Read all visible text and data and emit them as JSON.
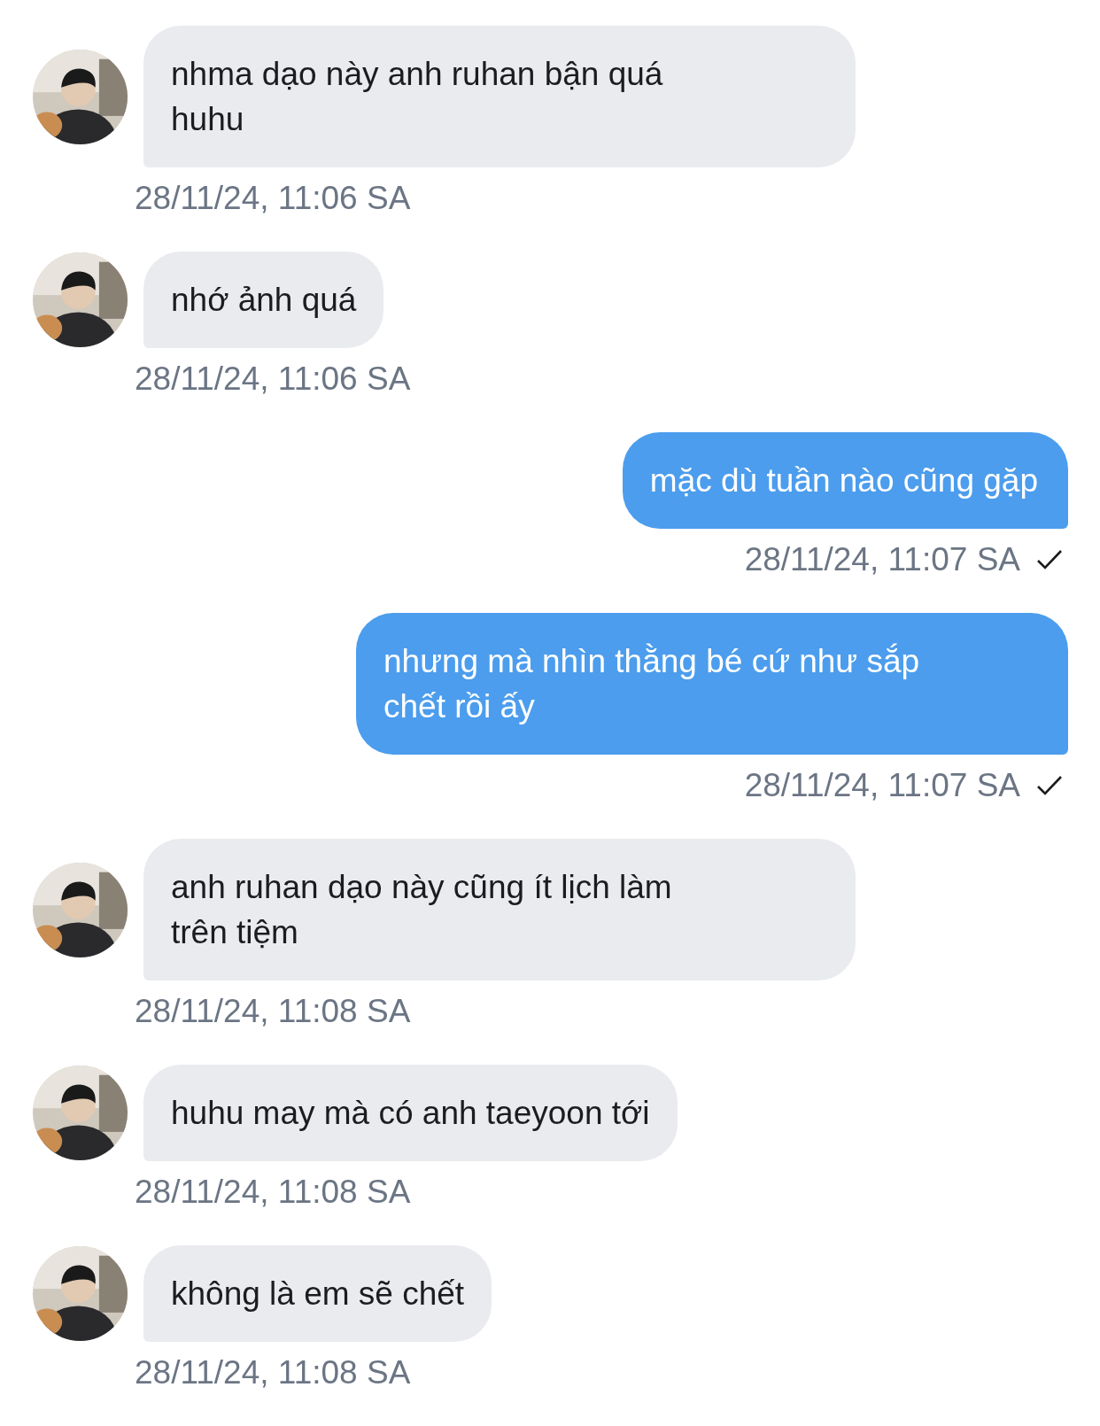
{
  "messages": [
    {
      "kind": "received",
      "avatar": {
        "kind": "picture"
      },
      "lines": [
        "nhma dạo này anh ruhan bận quá",
        "huhu"
      ],
      "time": "28/11/24, 11:06 SA"
    },
    {
      "kind": "received",
      "avatar": {
        "kind": "picture"
      },
      "lines": [
        "nhớ ảnh quá"
      ],
      "time": "28/11/24, 11:06 SA"
    },
    {
      "kind": "sent",
      "lines": [
        "mặc dù tuần nào cũng gặp"
      ],
      "time": "28/11/24, 11:07 SA",
      "delivered": true
    },
    {
      "kind": "sent",
      "lines": [
        "nhưng mà nhìn thằng bé cứ như sắp",
        "chết rồi ấy"
      ],
      "time": "28/11/24, 11:07 SA",
      "delivered": true
    },
    {
      "kind": "received",
      "avatar": {
        "kind": "picture"
      },
      "lines": [
        "anh ruhan dạo này cũng ít lịch làm",
        "trên tiệm"
      ],
      "time": "28/11/24, 11:08 SA"
    },
    {
      "kind": "received",
      "avatar": {
        "kind": "picture"
      },
      "lines": [
        "huhu may mà có anh taeyoon tới"
      ],
      "time": "28/11/24, 11:08 SA"
    },
    {
      "kind": "received",
      "avatar": {
        "kind": "picture"
      },
      "lines": [
        "không là em sẽ chết"
      ],
      "time": "28/11/24, 11:08 SA"
    }
  ]
}
